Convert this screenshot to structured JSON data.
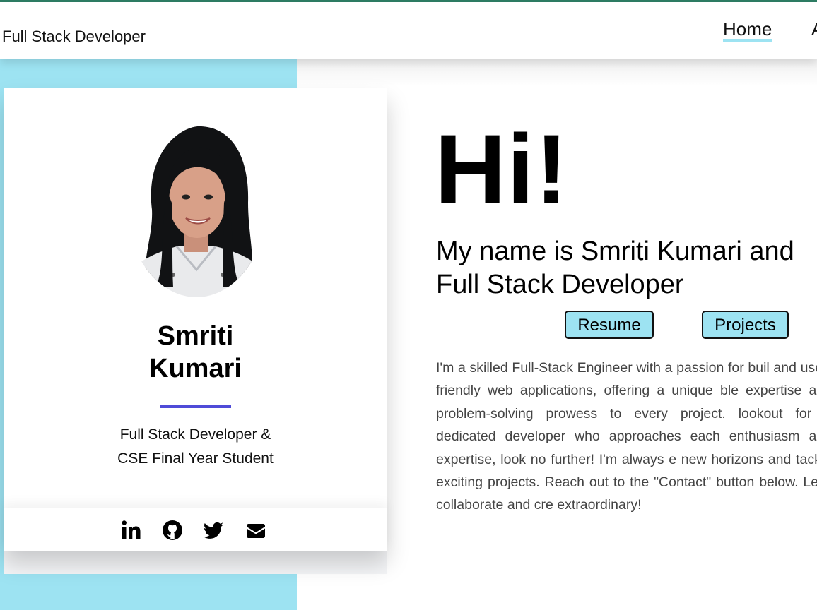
{
  "header": {
    "brand": "Full Stack Developer",
    "nav": [
      {
        "label": "Home"
      },
      {
        "label": "A"
      }
    ]
  },
  "profile": {
    "name_line1": "Smriti",
    "name_line2": "Kumari",
    "subtitle_line1": "Full Stack Developer &",
    "subtitle_line2": "CSE Final Year Student",
    "social": [
      "linkedin-icon",
      "github-icon",
      "twitter-icon",
      "envelope-icon"
    ]
  },
  "hero": {
    "greeting": "Hi!",
    "intro_line1": "My name is Smriti Kumari and",
    "intro_line2": "Full Stack Developer",
    "resume_label": "Resume",
    "projects_label": "Projects",
    "bio": "I'm a skilled Full-Stack Engineer with a passion for buil and user-friendly web applications, offering a unique ble expertise and problem-solving prowess to every project. lookout for a dedicated developer who approaches each enthusiasm and expertise, look no further! I'm always e new horizons and tackle exciting projects. Reach out to the \"Contact\" button below. Let's collaborate and cre extraordinary!"
  },
  "colors": {
    "accent": "#9de3f2",
    "divider": "#4f4bd8",
    "topline": "#2e7d64"
  }
}
